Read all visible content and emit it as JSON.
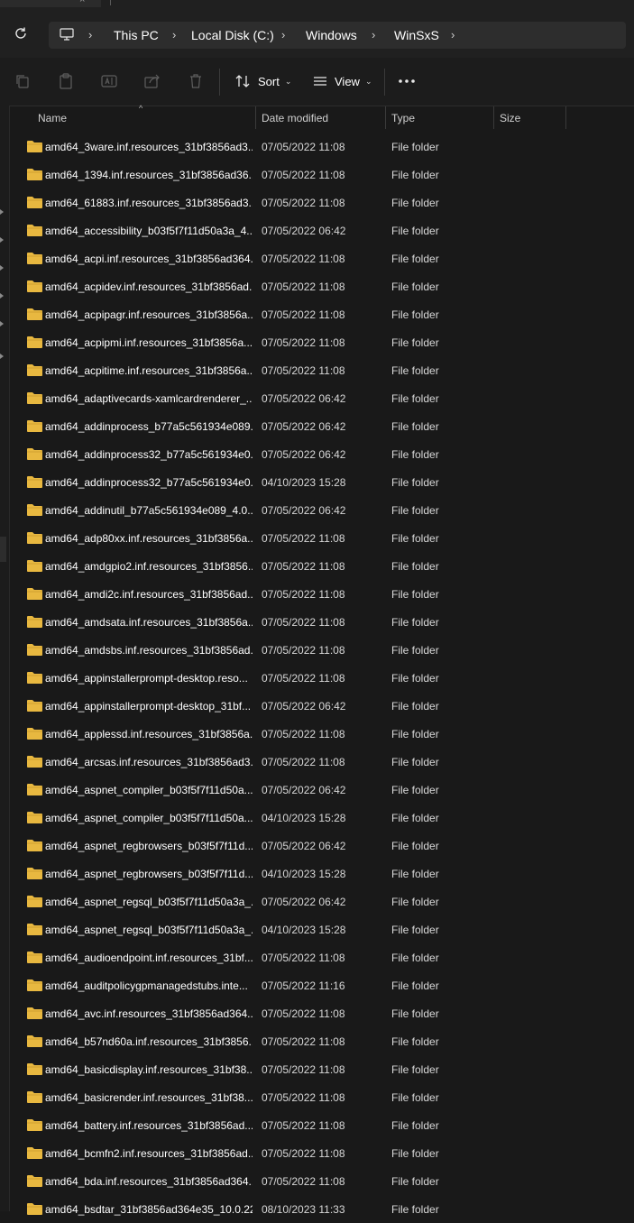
{
  "tab": {
    "close_glyph": "×"
  },
  "address": {
    "breadcrumbs": [
      "This PC",
      "Local Disk (C:)",
      "Windows",
      "WinSxS"
    ]
  },
  "toolbar": {
    "sort_label": "Sort",
    "view_label": "View",
    "more_glyph": "•••"
  },
  "columns": {
    "name": "Name",
    "date": "Date modified",
    "type": "Type",
    "size": "Size"
  },
  "files": [
    {
      "name": "amd64_3ware.inf.resources_31bf3856ad3...",
      "date": "07/05/2022 11:08",
      "type": "File folder",
      "size": ""
    },
    {
      "name": "amd64_1394.inf.resources_31bf3856ad36...",
      "date": "07/05/2022 11:08",
      "type": "File folder",
      "size": ""
    },
    {
      "name": "amd64_61883.inf.resources_31bf3856ad3...",
      "date": "07/05/2022 11:08",
      "type": "File folder",
      "size": ""
    },
    {
      "name": "amd64_accessibility_b03f5f7f11d50a3a_4....",
      "date": "07/05/2022 06:42",
      "type": "File folder",
      "size": ""
    },
    {
      "name": "amd64_acpi.inf.resources_31bf3856ad364...",
      "date": "07/05/2022 11:08",
      "type": "File folder",
      "size": ""
    },
    {
      "name": "amd64_acpidev.inf.resources_31bf3856ad...",
      "date": "07/05/2022 11:08",
      "type": "File folder",
      "size": ""
    },
    {
      "name": "amd64_acpipagr.inf.resources_31bf3856a...",
      "date": "07/05/2022 11:08",
      "type": "File folder",
      "size": ""
    },
    {
      "name": "amd64_acpipmi.inf.resources_31bf3856a...",
      "date": "07/05/2022 11:08",
      "type": "File folder",
      "size": ""
    },
    {
      "name": "amd64_acpitime.inf.resources_31bf3856a...",
      "date": "07/05/2022 11:08",
      "type": "File folder",
      "size": ""
    },
    {
      "name": "amd64_adaptivecards-xamlcardrenderer_...",
      "date": "07/05/2022 06:42",
      "type": "File folder",
      "size": ""
    },
    {
      "name": "amd64_addinprocess_b77a5c561934e089...",
      "date": "07/05/2022 06:42",
      "type": "File folder",
      "size": ""
    },
    {
      "name": "amd64_addinprocess32_b77a5c561934e0...",
      "date": "07/05/2022 06:42",
      "type": "File folder",
      "size": ""
    },
    {
      "name": "amd64_addinprocess32_b77a5c561934e0...",
      "date": "04/10/2023 15:28",
      "type": "File folder",
      "size": ""
    },
    {
      "name": "amd64_addinutil_b77a5c561934e089_4.0....",
      "date": "07/05/2022 06:42",
      "type": "File folder",
      "size": ""
    },
    {
      "name": "amd64_adp80xx.inf.resources_31bf3856a...",
      "date": "07/05/2022 11:08",
      "type": "File folder",
      "size": ""
    },
    {
      "name": "amd64_amdgpio2.inf.resources_31bf3856...",
      "date": "07/05/2022 11:08",
      "type": "File folder",
      "size": ""
    },
    {
      "name": "amd64_amdi2c.inf.resources_31bf3856ad...",
      "date": "07/05/2022 11:08",
      "type": "File folder",
      "size": ""
    },
    {
      "name": "amd64_amdsata.inf.resources_31bf3856a...",
      "date": "07/05/2022 11:08",
      "type": "File folder",
      "size": ""
    },
    {
      "name": "amd64_amdsbs.inf.resources_31bf3856ad...",
      "date": "07/05/2022 11:08",
      "type": "File folder",
      "size": ""
    },
    {
      "name": "amd64_appinstallerprompt-desktop.reso...",
      "date": "07/05/2022 11:08",
      "type": "File folder",
      "size": ""
    },
    {
      "name": "amd64_appinstallerprompt-desktop_31bf...",
      "date": "07/05/2022 06:42",
      "type": "File folder",
      "size": ""
    },
    {
      "name": "amd64_applessd.inf.resources_31bf3856a...",
      "date": "07/05/2022 11:08",
      "type": "File folder",
      "size": ""
    },
    {
      "name": "amd64_arcsas.inf.resources_31bf3856ad3...",
      "date": "07/05/2022 11:08",
      "type": "File folder",
      "size": ""
    },
    {
      "name": "amd64_aspnet_compiler_b03f5f7f11d50a...",
      "date": "07/05/2022 06:42",
      "type": "File folder",
      "size": ""
    },
    {
      "name": "amd64_aspnet_compiler_b03f5f7f11d50a...",
      "date": "04/10/2023 15:28",
      "type": "File folder",
      "size": ""
    },
    {
      "name": "amd64_aspnet_regbrowsers_b03f5f7f11d...",
      "date": "07/05/2022 06:42",
      "type": "File folder",
      "size": ""
    },
    {
      "name": "amd64_aspnet_regbrowsers_b03f5f7f11d...",
      "date": "04/10/2023 15:28",
      "type": "File folder",
      "size": ""
    },
    {
      "name": "amd64_aspnet_regsql_b03f5f7f11d50a3a_...",
      "date": "07/05/2022 06:42",
      "type": "File folder",
      "size": ""
    },
    {
      "name": "amd64_aspnet_regsql_b03f5f7f11d50a3a_...",
      "date": "04/10/2023 15:28",
      "type": "File folder",
      "size": ""
    },
    {
      "name": "amd64_audioendpoint.inf.resources_31bf...",
      "date": "07/05/2022 11:08",
      "type": "File folder",
      "size": ""
    },
    {
      "name": "amd64_auditpolicygpmanagedstubs.inte...",
      "date": "07/05/2022 11:16",
      "type": "File folder",
      "size": ""
    },
    {
      "name": "amd64_avc.inf.resources_31bf3856ad364...",
      "date": "07/05/2022 11:08",
      "type": "File folder",
      "size": ""
    },
    {
      "name": "amd64_b57nd60a.inf.resources_31bf3856...",
      "date": "07/05/2022 11:08",
      "type": "File folder",
      "size": ""
    },
    {
      "name": "amd64_basicdisplay.inf.resources_31bf38...",
      "date": "07/05/2022 11:08",
      "type": "File folder",
      "size": ""
    },
    {
      "name": "amd64_basicrender.inf.resources_31bf38...",
      "date": "07/05/2022 11:08",
      "type": "File folder",
      "size": ""
    },
    {
      "name": "amd64_battery.inf.resources_31bf3856ad...",
      "date": "07/05/2022 11:08",
      "type": "File folder",
      "size": ""
    },
    {
      "name": "amd64_bcmfn2.inf.resources_31bf3856ad...",
      "date": "07/05/2022 11:08",
      "type": "File folder",
      "size": ""
    },
    {
      "name": "amd64_bda.inf.resources_31bf3856ad364...",
      "date": "07/05/2022 11:08",
      "type": "File folder",
      "size": ""
    },
    {
      "name": "amd64_bsdtar_31bf3856ad364e35_10.0.22...",
      "date": "08/10/2023 11:33",
      "type": "File folder",
      "size": ""
    }
  ],
  "colors": {
    "folder": "#e8b840",
    "background": "#191919",
    "text": "#ffffff"
  }
}
